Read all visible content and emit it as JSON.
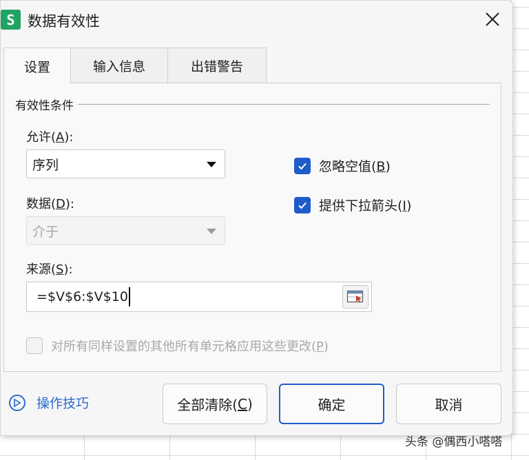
{
  "window": {
    "title": "数据有效性",
    "app_icon_letter": "S"
  },
  "tabs": [
    {
      "label": "设置"
    },
    {
      "label": "输入信息"
    },
    {
      "label": "出错警告"
    }
  ],
  "group": {
    "title": "有效性条件"
  },
  "allow": {
    "label": "允许(",
    "key": "A",
    "suffix": "):",
    "value": "序列"
  },
  "data": {
    "label": "数据(",
    "key": "D",
    "suffix": "):",
    "value": "介于"
  },
  "ignore_blank": {
    "label": "忽略空值(",
    "key": "B",
    "suffix": ")",
    "checked": true
  },
  "dropdown_arrow": {
    "label": "提供下拉箭头(",
    "key": "I",
    "suffix": ")",
    "checked": true
  },
  "source": {
    "label": "来源(",
    "key": "S",
    "suffix": "):",
    "value": "=$V$6:$V$10"
  },
  "apply_all": {
    "label": "对所有同样设置的其他所有单元格应用这些更改(",
    "key": "P",
    "suffix": ")",
    "checked": false
  },
  "footer": {
    "tips_label": "操作技巧",
    "clear": {
      "label": "全部清除(",
      "key": "C",
      "suffix": ")"
    },
    "ok": {
      "label": "确定"
    },
    "cancel": {
      "label": "取消"
    }
  },
  "watermark": "头条 @偶西小嗒嗒",
  "colors": {
    "accent": "#1e5dc9",
    "app_icon": "#1fa463",
    "link": "#2a6bd1"
  },
  "icons": [
    "spreadsheet-app-icon",
    "close-icon",
    "checkmark-icon",
    "range-picker-icon",
    "play-circle-icon",
    "chevron-down-icon"
  ]
}
